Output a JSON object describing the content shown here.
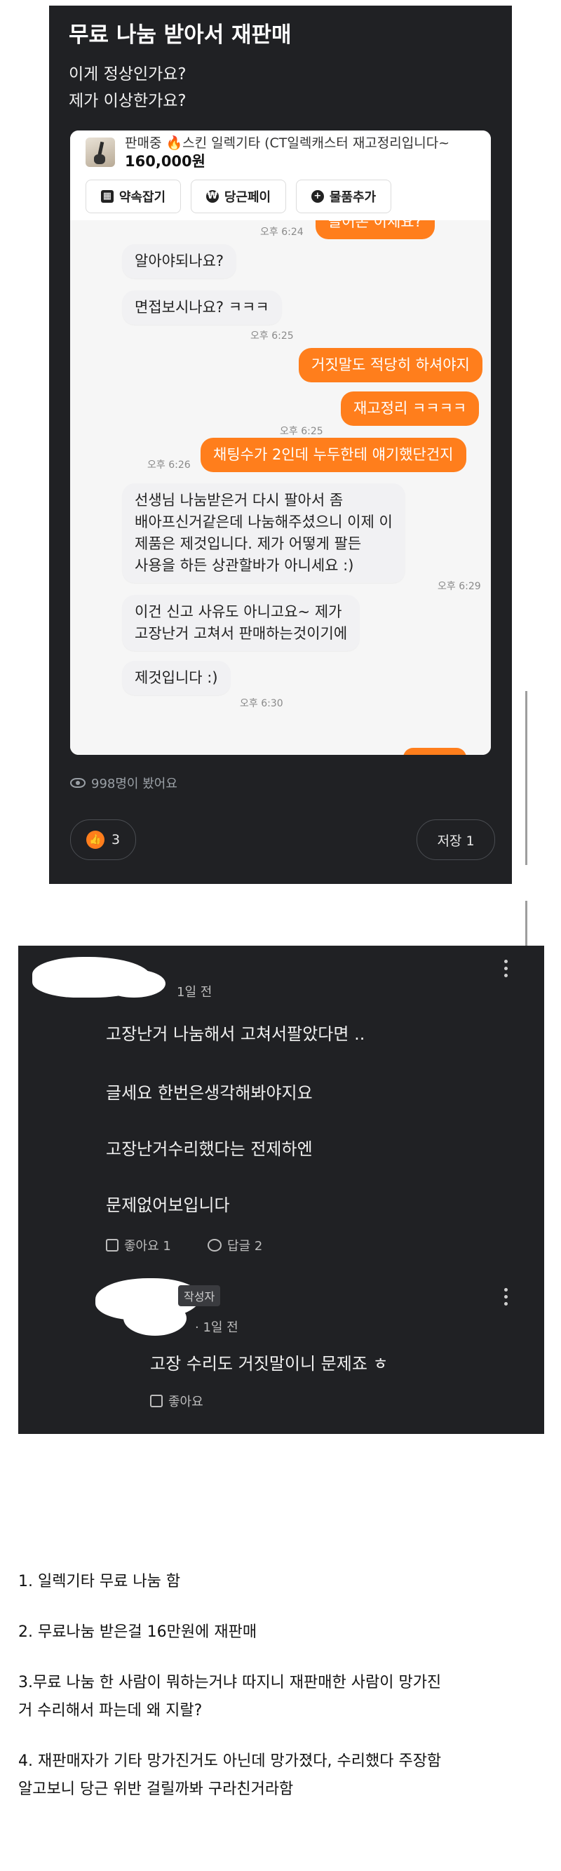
{
  "post": {
    "title": "무료 나눔 받아서 재판매",
    "line1": "이게 정상인가요?",
    "line2": "제가 이상한가요?",
    "item_title": "판매중 🔥스킨 일렉기타 (CT일렉캐스터 재고정리입니다~",
    "item_price": "160,000원",
    "chips": [
      "약속잡기",
      "당근페이",
      "물품추가"
    ],
    "messages": [
      {
        "side": "out",
        "text": "쓸어본 이세요?",
        "time": "오후 6:24"
      },
      {
        "side": "in",
        "text": "알아야되나요?"
      },
      {
        "side": "in",
        "text": "면접보시나요? ㅋㅋㅋ",
        "time": "오후 6:25"
      },
      {
        "side": "out",
        "text": "거짓말도 적당히 하셔야지"
      },
      {
        "side": "out",
        "text": "재고정리 ㅋㅋㅋㅋ",
        "time": "오후 6:25"
      },
      {
        "side": "out",
        "text": "채팅수가 2인데 누두한테 얘기했단건지",
        "time": "오후 6:26"
      },
      {
        "side": "in",
        "lines": [
          "선생님 나눔받은거 다시 팔아서 좀",
          "배아프신거같은데 나눔해주셨으니 이제 이",
          "제품은 제것입니다. 제가 어떻게 팔든",
          "사용을 하든 상관할바가 아니세요 :)"
        ],
        "time": "오후 6:29"
      },
      {
        "side": "in",
        "lines": [
          "이건 신고 사유도 아니고요~ 제가",
          "고장난거 고쳐서 판매하는것이기에"
        ]
      },
      {
        "side": "in",
        "text": "제것입니다 :)",
        "time": "오후 6:30"
      }
    ],
    "views": "998명이 봤어요",
    "like_count": "3",
    "save_label": "저장 1"
  },
  "comments": {
    "first": {
      "meta": "1일 전",
      "lines": [
        "고장난거 나눔해서 고쳐서팔았다면 ..",
        "글세요 한번은생각해봐야지요",
        "고장난거수리했다는 전제하엔",
        "문제없어보입니다"
      ],
      "like_label": "좋아요 1",
      "reply_label": "답글 2"
    },
    "reply": {
      "badge": "작성자",
      "meta": "· 1일 전",
      "text": "고장 수리도 거짓말이니 문제죠 ㅎ",
      "like_label": "좋아요"
    }
  },
  "summary": [
    "1. 일렉기타 무료 나눔 함",
    "2. 무료나눔 받은걸 16만원에 재판매",
    "3.무료 나눔 한 사람이 뭐하는거냐 따지니 재판매한 사람이 망가진",
    "거 수리해서 파는데 왜 지랄?",
    "4. 재판매자가 기타 망가진거도 아닌데 망가졌다, 수리했다 주장함",
    "알고보니 당근 위반 걸릴까봐 구라친거라함"
  ]
}
